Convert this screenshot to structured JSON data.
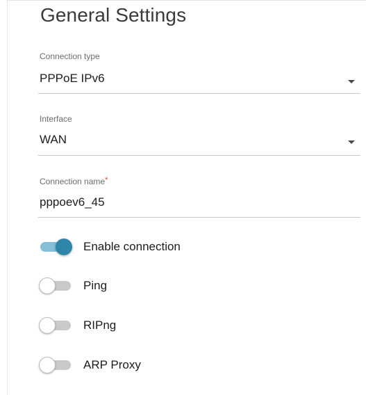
{
  "title": "General Settings",
  "fields": {
    "connection_type": {
      "label": "Connection type",
      "value": "PPPoE IPv6"
    },
    "interface": {
      "label": "Interface",
      "value": "WAN"
    },
    "connection_name": {
      "label": "Connection name",
      "required_mark": "*",
      "value": "pppoev6_45"
    }
  },
  "toggles": [
    {
      "label": "Enable connection",
      "state": "on"
    },
    {
      "label": "Ping",
      "state": "off"
    },
    {
      "label": "RIPng",
      "state": "off"
    },
    {
      "label": "ARP Proxy",
      "state": "off"
    }
  ],
  "colors": {
    "accent": "#2e86ab",
    "required": "#e53935"
  }
}
